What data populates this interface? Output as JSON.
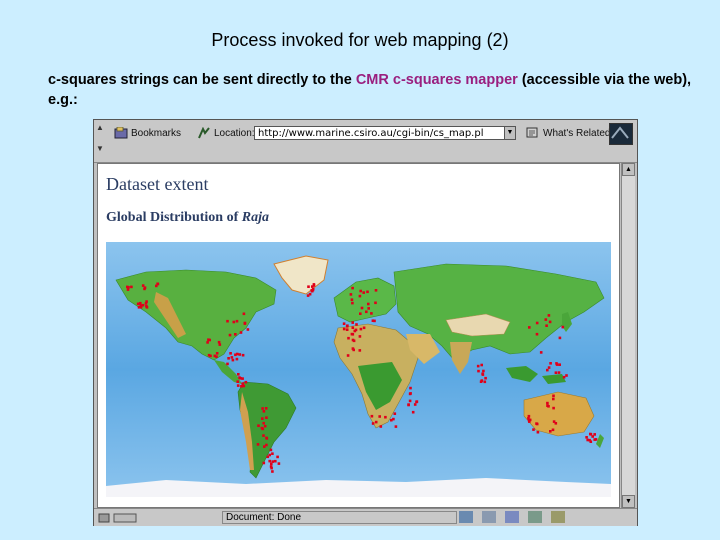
{
  "slide": {
    "title": "Process invoked for web mapping (2)",
    "body_before": "c-squares strings can be sent directly to the ",
    "body_link": "CMR c-squares mapper",
    "body_after": " (accessible via the web), e.g.:"
  },
  "browser": {
    "toolbar": {
      "bookmarks_label": "Bookmarks",
      "location_label": "Location:",
      "url": "http://www.marine.csiro.au/cgi-bin/cs_map.pl",
      "whats_related_label": "What's Related"
    },
    "page": {
      "heading": "Dataset extent",
      "subheading_prefix": "Global Distribution of ",
      "subheading_taxon": "Raja"
    },
    "status": {
      "text": "Document: Done"
    }
  },
  "colors": {
    "background": "#cceeff",
    "link": "#9a1f7f",
    "heading": "#2b3d63",
    "record_marker": "#e0001a",
    "ocean": "#6fb3e6",
    "land_low": "#3aa23a",
    "land_high": "#e0b060"
  },
  "icons": [
    "bookmarks-icon",
    "location-icon",
    "whats-related-icon",
    "browser-logo-icon",
    "lock-icon",
    "status-icons"
  ]
}
